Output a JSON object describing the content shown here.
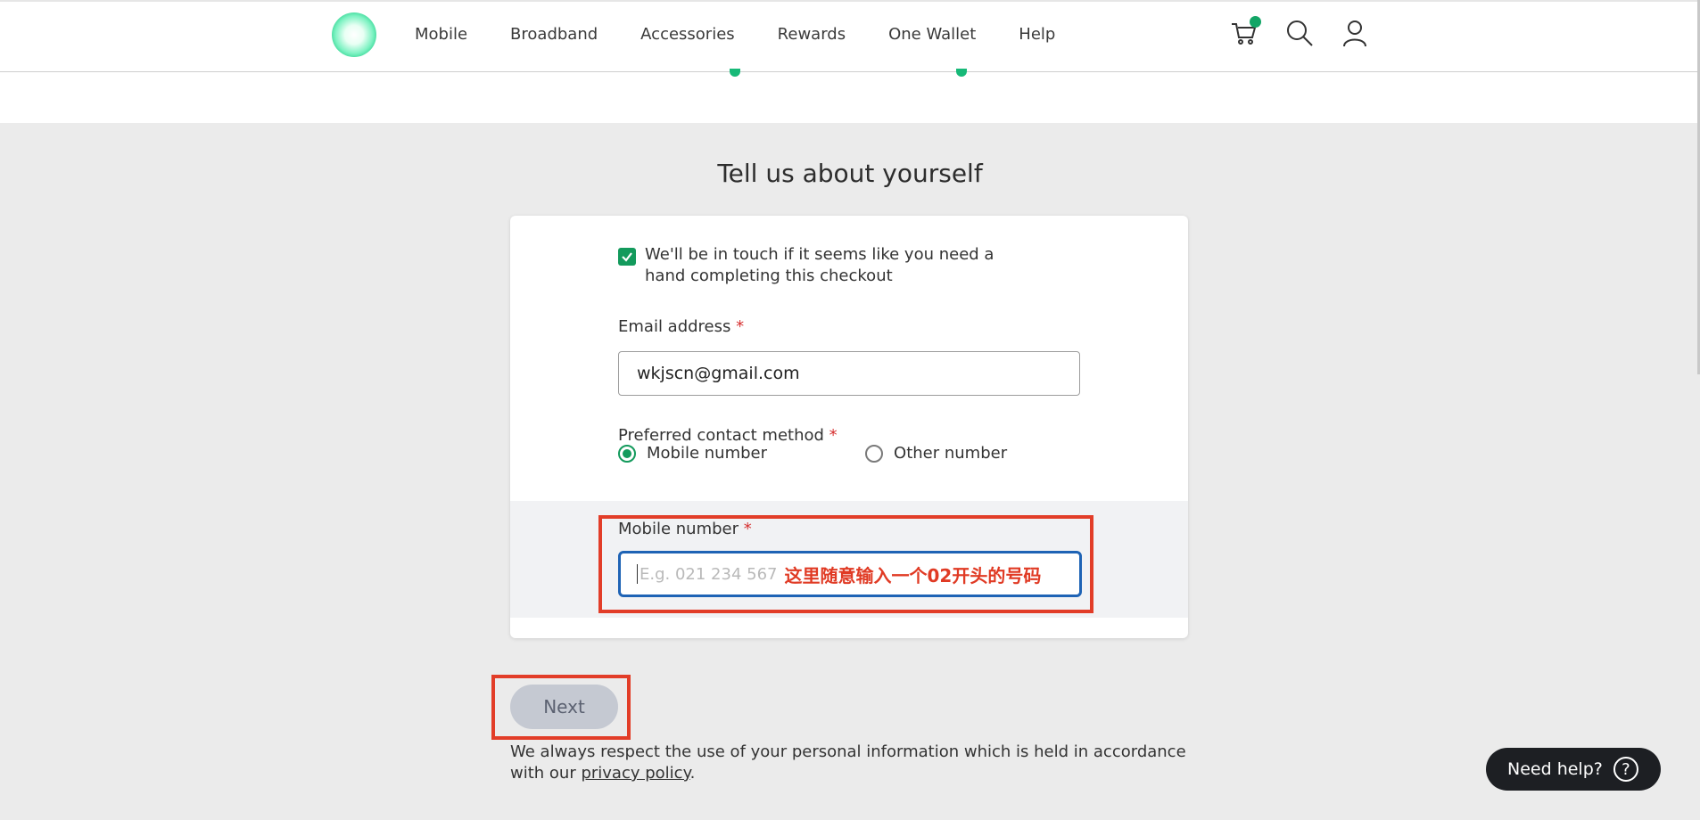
{
  "nav": {
    "items": [
      {
        "label": "Mobile"
      },
      {
        "label": "Broadband"
      },
      {
        "label": "Accessories"
      },
      {
        "label": "Rewards"
      },
      {
        "label": "One Wallet"
      },
      {
        "label": "Help"
      }
    ]
  },
  "header_icons": [
    "cart-icon",
    "search-icon",
    "account-icon"
  ],
  "colors": {
    "brand_green": "#139a5c",
    "focus_blue": "#1e63b5",
    "annotation_red": "#e23d28",
    "required_red": "#d63030"
  },
  "form": {
    "title": "Tell us about yourself",
    "consent": {
      "checked": true,
      "text": "We'll be in touch if it seems like you need a hand completing this checkout"
    },
    "email": {
      "label": "Email address",
      "required_marker": "*",
      "value": "wkjscn@gmail.com"
    },
    "contact_method": {
      "label": "Preferred contact method",
      "required_marker": "*",
      "options": [
        {
          "label": "Mobile number",
          "selected": true
        },
        {
          "label": "Other number",
          "selected": false
        }
      ]
    },
    "mobile": {
      "label": "Mobile number",
      "required_marker": "*",
      "placeholder": "E.g. 021 234 567",
      "value": ""
    },
    "annotation": "这里随意输入一个02开头的号码"
  },
  "next_button": {
    "label": "Next"
  },
  "privacy": {
    "text_before": "We always respect the use of your personal information which is held in accordance with our ",
    "link_text": "privacy policy",
    "text_after": "."
  },
  "help_button": {
    "label": "Need help?",
    "icon": "?"
  }
}
